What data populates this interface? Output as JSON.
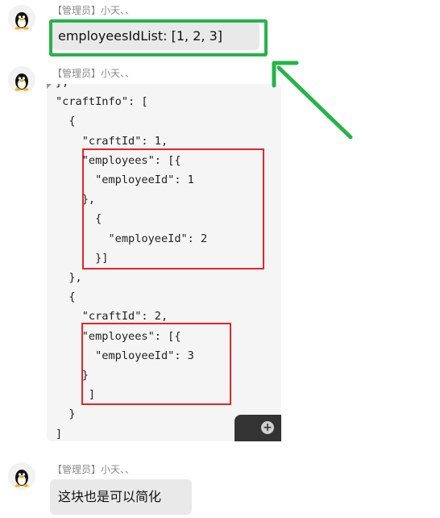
{
  "messages": [
    {
      "sender": "【管理员】小天、、",
      "text": "employeesIdList: [1, 2, 3]"
    },
    {
      "sender": "【管理员】小天、、",
      "code": "},\n\"craftInfo\": [\n  {\n    \"craftId\": 1,\n    \"employees\": [{\n      \"employeeId\": 1\n    },\n      {\n        \"employeeId\": 2\n      }]\n  },\n  {\n    \"craftId\": 2,\n    \"employees\": [{\n      \"employeeId\": 3\n    }\n     ]\n  }\n]"
    },
    {
      "sender": "【管理员】小天、、",
      "text": "这块也是可以简化"
    }
  ],
  "annotations": {
    "highlight_color": "#27b34a",
    "box_color": "#e3252c"
  },
  "icons": {
    "avatar": "penguin-avatar-icon",
    "expand": "plus-circle-icon"
  }
}
